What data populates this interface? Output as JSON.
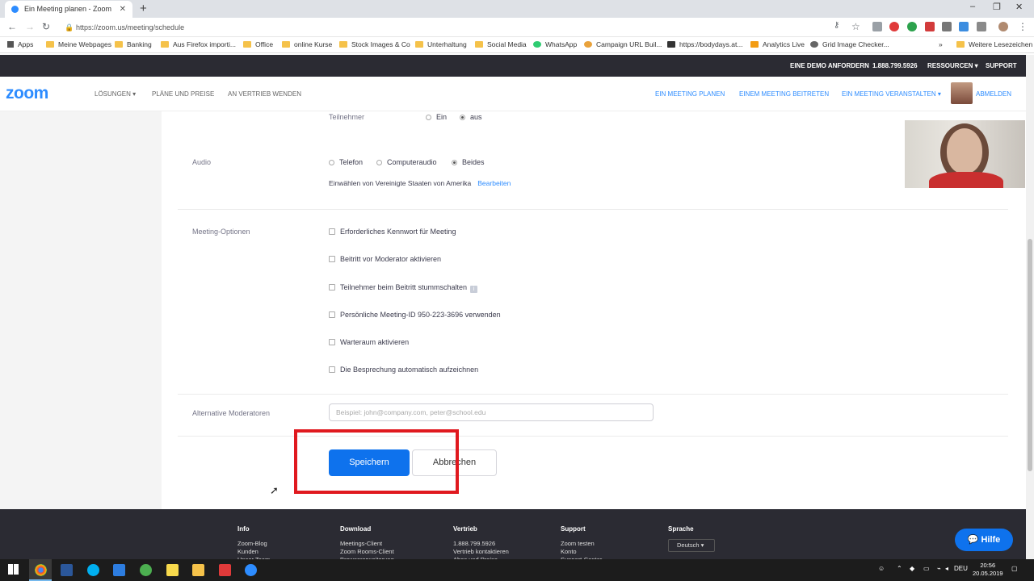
{
  "browser": {
    "tab_title": "Ein Meeting planen - Zoom",
    "new_tab": "+",
    "url": "https://zoom.us/meeting/schedule",
    "window_controls": [
      "–",
      "❐",
      "✕"
    ],
    "bookmarks": [
      "Apps",
      "Meine Webpages",
      "Banking",
      "Aus Firefox importi...",
      "Office",
      "online Kurse",
      "Stock Images & Co",
      "Unterhaltung",
      "Social Media",
      "WhatsApp",
      "Campaign URL Buil...",
      "https://bodydays.at...",
      "Analytics Live",
      "Grid Image Checker...",
      "»",
      "Weitere Lesezeichen"
    ]
  },
  "zoom_topbar": {
    "demo": "EINE DEMO ANFORDERN",
    "phone": "1.888.799.5926",
    "resources": "RESSOURCEN ▾",
    "support": "SUPPORT"
  },
  "zoom_nav": {
    "logo": "zoom",
    "solutions": "LÖSUNGEN ▾",
    "plans": "PLÄNE UND PREISE",
    "sales": "AN VERTRIEB WENDEN",
    "schedule": "EIN MEETING PLANEN",
    "join": "EINEM MEETING BEITRETEN",
    "host": "EIN MEETING VERANSTALTEN ▾",
    "logout": "ABMELDEN"
  },
  "form": {
    "participants_label": "Teilnehmer",
    "participants_on": "Ein",
    "participants_off": "aus",
    "audio_label": "Audio",
    "audio_phone": "Telefon",
    "audio_computer": "Computeraudio",
    "audio_both": "Beides",
    "dial_in": "Einwählen von Vereinigte Staaten von Amerika",
    "edit": "Bearbeiten",
    "options_label": "Meeting-Optionen",
    "options": [
      "Erforderliches Kennwort für Meeting",
      "Beitritt vor Moderator aktivieren",
      "Teilnehmer beim Beitritt stummschalten",
      "Persönliche Meeting-ID 950-223-3696 verwenden",
      "Warteraum aktivieren",
      "Die Besprechung automatisch aufzeichnen"
    ],
    "info_glyph": "i",
    "alt_hosts_label": "Alternative Moderatoren",
    "alt_hosts_placeholder": "Beispiel: john@company.com, peter@school.edu",
    "save": "Speichern",
    "cancel": "Abbrechen"
  },
  "footer": {
    "info": "Info",
    "info_items": [
      "Zoom-Blog",
      "Kunden",
      "Unser Team"
    ],
    "download": "Download",
    "download_items": [
      "Meetings-Client",
      "Zoom Rooms-Client",
      "Browsererweiterung"
    ],
    "sales": "Vertrieb",
    "sales_items": [
      "1.888.799.5926",
      "Vertrieb kontaktieren",
      "Abos und Preise"
    ],
    "support": "Support",
    "support_items": [
      "Zoom testen",
      "Konto",
      "Support-Center"
    ],
    "language": "Sprache",
    "language_value": "Deutsch ▾",
    "help": "Hilfe"
  },
  "taskbar": {
    "lang": "DEU",
    "time": "20:56",
    "date": "20.05.2019"
  },
  "colors": {
    "zoom_blue": "#2d8cff",
    "button_blue": "#0e72ed",
    "highlight_red": "#e0191f",
    "dark_bar": "#2b2b33"
  }
}
